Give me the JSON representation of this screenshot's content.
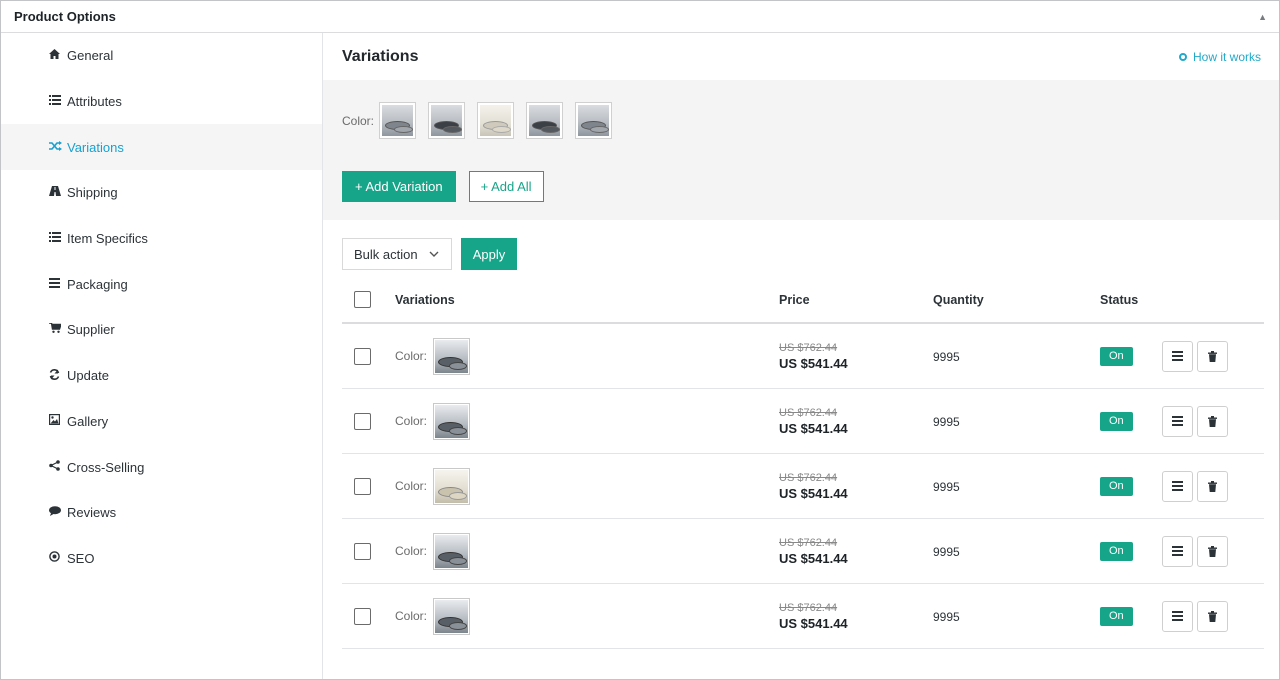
{
  "panel": {
    "title": "Product Options"
  },
  "sidebar": {
    "items": [
      {
        "label": "General",
        "icon": "home-icon",
        "glyph": "🏠"
      },
      {
        "label": "Attributes",
        "icon": "list-icon",
        "glyph": "☰"
      },
      {
        "label": "Variations",
        "icon": "shuffle-icon",
        "glyph": "⤨",
        "active": true
      },
      {
        "label": "Shipping",
        "icon": "road-icon",
        "glyph": "▲"
      },
      {
        "label": "Item Specifics",
        "icon": "list-icon",
        "glyph": "☰"
      },
      {
        "label": "Packaging",
        "icon": "bars-icon",
        "glyph": "≡"
      },
      {
        "label": "Supplier",
        "icon": "cart-icon",
        "glyph": "🛒"
      },
      {
        "label": "Update",
        "icon": "refresh-icon",
        "glyph": "⟳"
      },
      {
        "label": "Gallery",
        "icon": "image-icon",
        "glyph": "▣"
      },
      {
        "label": "Cross-Selling",
        "icon": "share-icon",
        "glyph": "⋖"
      },
      {
        "label": "Reviews",
        "icon": "comment-icon",
        "glyph": "●"
      },
      {
        "label": "SEO",
        "icon": "target-icon",
        "glyph": "◉"
      }
    ]
  },
  "main": {
    "title": "Variations",
    "how_link": "How it works",
    "color_label": "Color:",
    "add_variation": "+ Add Variation",
    "add_all": "+ Add All",
    "bulk_action": "Bulk action",
    "apply": "Apply"
  },
  "table": {
    "headers": {
      "variations": "Variations",
      "price": "Price",
      "quantity": "Quantity",
      "status": "Status"
    },
    "rows": [
      {
        "color_label": "Color:",
        "old_price": "US $762.44",
        "price": "US $541.44",
        "quantity": "9995",
        "status": "On"
      },
      {
        "color_label": "Color:",
        "old_price": "US $762.44",
        "price": "US $541.44",
        "quantity": "9995",
        "status": "On"
      },
      {
        "color_label": "Color:",
        "old_price": "US $762.44",
        "price": "US $541.44",
        "quantity": "9995",
        "status": "On"
      },
      {
        "color_label": "Color:",
        "old_price": "US $762.44",
        "price": "US $541.44",
        "quantity": "9995",
        "status": "On"
      },
      {
        "color_label": "Color:",
        "old_price": "US $762.44",
        "price": "US $541.44",
        "quantity": "9995",
        "status": "On"
      }
    ]
  },
  "colors": {
    "accent": "#17a589",
    "link": "#22a9c9",
    "active_nav": "#1aa0ce"
  }
}
